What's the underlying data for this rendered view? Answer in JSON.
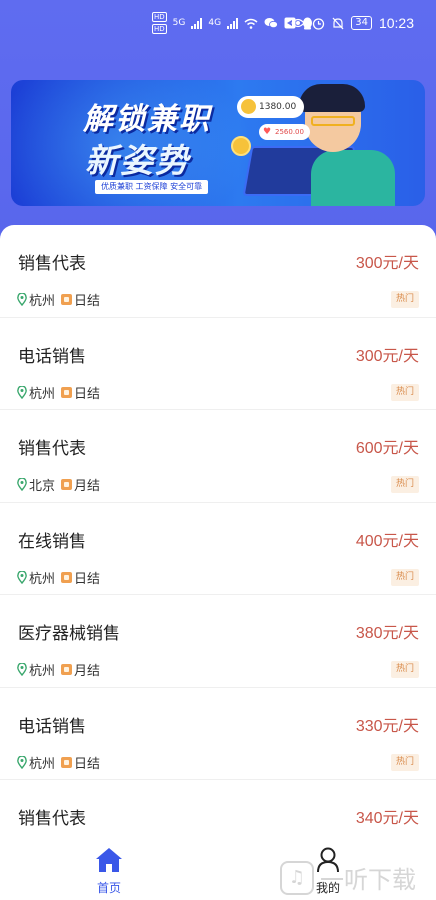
{
  "status_bar": {
    "hd1": "HD",
    "hd2": "HD",
    "net1": "5G",
    "net2": "4G",
    "battery": "34",
    "time": "10:23"
  },
  "banner": {
    "title_line1": "解锁兼职",
    "title_line2": "新姿势",
    "subtitle": "优质兼职  工资保障  安全可靠",
    "coin_amount": "1380.00",
    "heart_amount": "2560.00"
  },
  "jobs": [
    {
      "title": "销售代表",
      "salary": "300元/天",
      "city": "杭州",
      "pay_cycle": "日结",
      "tag": "热门"
    },
    {
      "title": "电话销售",
      "salary": "300元/天",
      "city": "杭州",
      "pay_cycle": "日结",
      "tag": "热门"
    },
    {
      "title": "销售代表",
      "salary": "600元/天",
      "city": "北京",
      "pay_cycle": "月结",
      "tag": "热门"
    },
    {
      "title": "在线销售",
      "salary": "400元/天",
      "city": "杭州",
      "pay_cycle": "日结",
      "tag": "热门"
    },
    {
      "title": "医疗器械销售",
      "salary": "380元/天",
      "city": "杭州",
      "pay_cycle": "月结",
      "tag": "热门"
    },
    {
      "title": "电话销售",
      "salary": "330元/天",
      "city": "杭州",
      "pay_cycle": "日结",
      "tag": "热门"
    },
    {
      "title": "销售代表",
      "salary": "340元/天",
      "city": "",
      "pay_cycle": "",
      "tag": ""
    }
  ],
  "nav": {
    "home_label": "首页",
    "mine_label": "我的"
  },
  "watermark": {
    "text": "一听下载"
  },
  "colors": {
    "header": "#5f6cf0",
    "salary": "#c8574a",
    "active_nav": "#3a57e8",
    "hot_tag_bg": "#fbefe2"
  }
}
